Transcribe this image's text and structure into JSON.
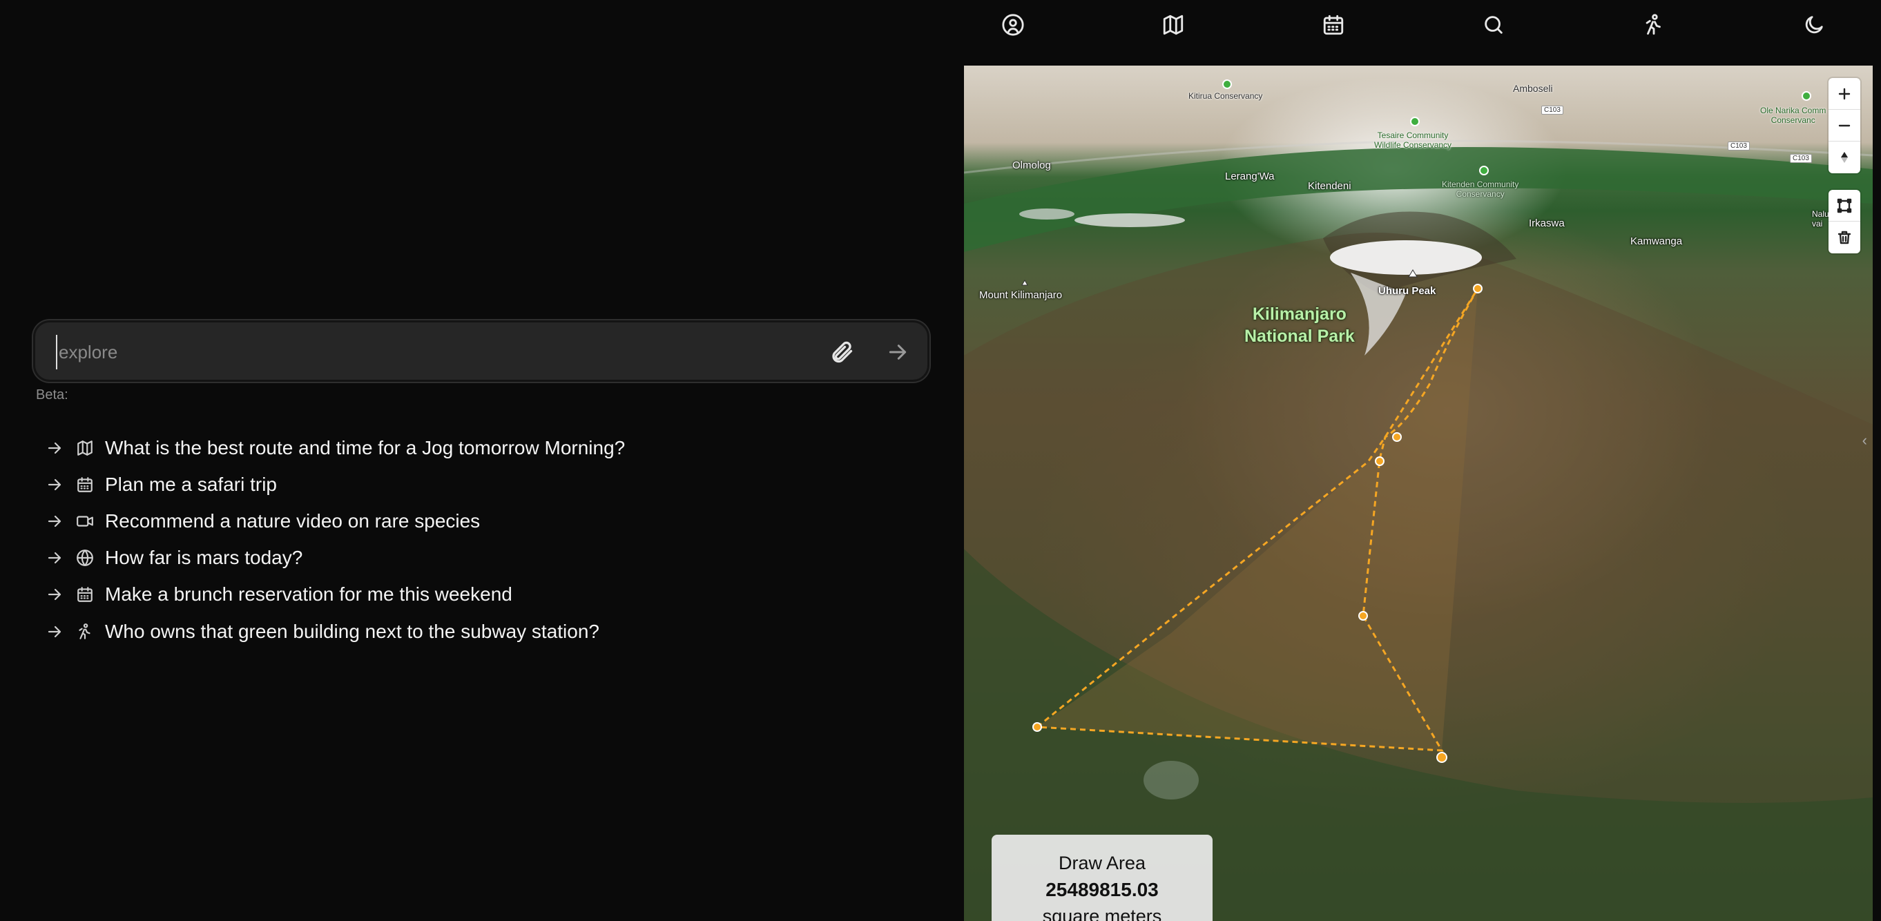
{
  "nav": {
    "icons": [
      "user-circle-icon",
      "map-icon",
      "calendar-icon",
      "search-icon",
      "hiker-icon",
      "moon-icon"
    ]
  },
  "search": {
    "placeholder": "explore",
    "value": ""
  },
  "beta_label": "Beta:",
  "suggestions": [
    {
      "icon": "map-icon",
      "text": "What is the best route and time for a Jog tomorrow Morning?"
    },
    {
      "icon": "calendar-icon",
      "text": "Plan me a safari trip"
    },
    {
      "icon": "video-icon",
      "text": "Recommend a nature video on rare species"
    },
    {
      "icon": "globe-icon",
      "text": "How far is mars today?"
    },
    {
      "icon": "calendar-icon",
      "text": "Make a brunch reservation for me this weekend"
    },
    {
      "icon": "hiker-icon",
      "text": "Who owns that green building next to the subway station?"
    }
  ],
  "map": {
    "labels": {
      "kitirua": "Kitirua Conservancy",
      "amboseli": "Amboseli",
      "tesaire": "Tesaire Community\nWildlife Conservancy",
      "olenarika": "Ole Narika Comm\nConservanc",
      "olmolog": "Olmolog",
      "lerangwa": "Lerang'Wa",
      "kitendeni": "Kitendeni",
      "kitenden_cons": "Kitenden Community\nConservancy",
      "irkaswa": "Irkaswa",
      "kamwanga": "Kamwanga",
      "nalu": "Nalu\nvai",
      "mount_kilimanjaro": "Mount Kilimanjaro",
      "uhuru_peak": "Uhuru Peak",
      "park": "Kilimanjaro\nNational Park",
      "road1": "C103",
      "road2": "C103",
      "road3": "C103"
    },
    "accent_color": "#f5a623",
    "controls": {
      "zoom_in": "plus-icon",
      "zoom_out": "minus-icon",
      "compass": "compass-icon",
      "draw_polygon": "polygon-icon",
      "trash": "trash-icon"
    },
    "area": {
      "title": "Draw Area",
      "value": "25489815.03",
      "unit": "square meters"
    }
  }
}
